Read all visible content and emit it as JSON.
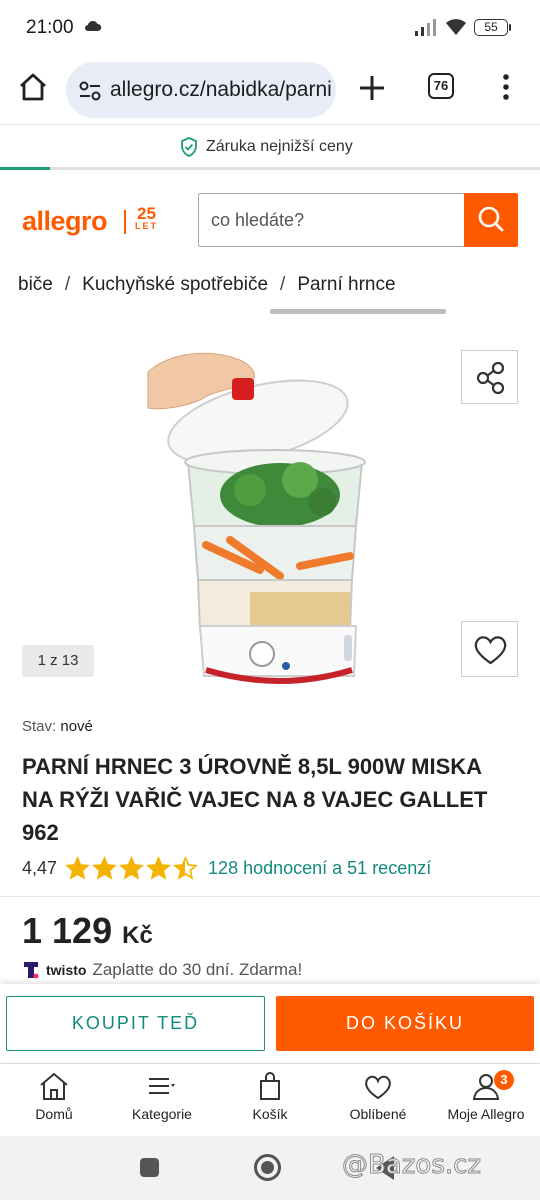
{
  "status": {
    "time": "21:00",
    "battery": "55"
  },
  "browser": {
    "url": "allegro.cz/nabidka/parni",
    "tab_count": "76"
  },
  "banner": {
    "guarantee": "Záruka nejnižší ceny"
  },
  "header": {
    "logo": "allegro",
    "anniversary_number": "25",
    "anniversary_word": "LET",
    "search_placeholder": "co hledáte?"
  },
  "breadcrumb": {
    "items": [
      "spotřebiče",
      "Kuchyňské spotřebiče",
      "Parní hrnce"
    ],
    "visible_first": "biče"
  },
  "gallery": {
    "counter": "1 z 13"
  },
  "product": {
    "condition_label": "Stav:",
    "condition_value": "nové",
    "title": "PARNÍ HRNEC 3 ÚROVNĚ 8,5L 900W MISKA NA RÝŽI VAŘIČ VAJEC NA 8 VAJEC GALLET 962",
    "rating_value": "4,47",
    "rating_stars": 4.47,
    "reviews_text": "128 hodnocení a 51 recenzí",
    "price": "1 129",
    "currency": "Kč",
    "twisto_brand": "twisto",
    "twisto_text": "Zaplatte do 30 dní. Zdarma!"
  },
  "actions": {
    "buy_now": "KOUPIT TEĎ",
    "add_to_cart": "DO KOŠÍKU"
  },
  "bottom_nav": {
    "home": "Domů",
    "categories": "Kategorie",
    "cart": "Košík",
    "favorites": "Oblíbené",
    "my_allegro": "Moje Allegro",
    "my_allegro_badge": "3"
  },
  "watermark": "@Bazos.cz",
  "colors": {
    "brand": "#ff5a00",
    "accent_green": "#138a7e",
    "star": "#f5b301"
  }
}
